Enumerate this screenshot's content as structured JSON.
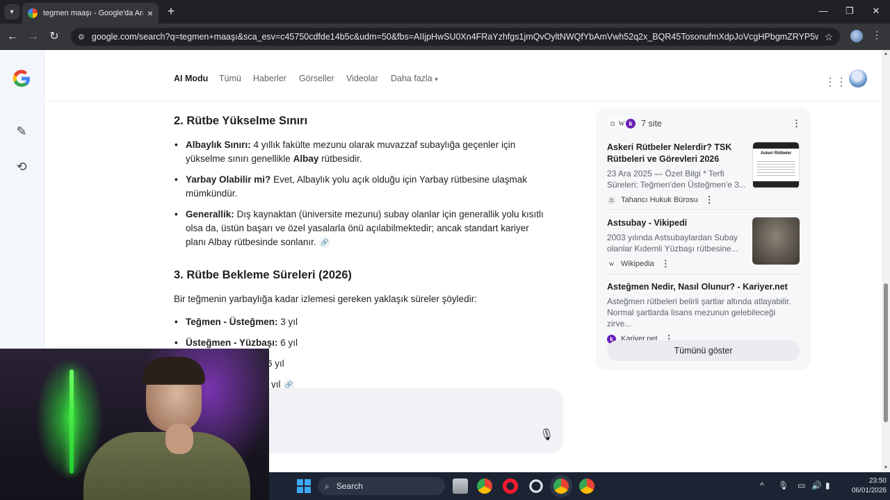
{
  "browser": {
    "tab_title": "tegmen maaşı - Google'da Ara",
    "url": "google.com/search?q=tegmen+maaşı&sca_esv=c45750cdfde14b5c&udm=50&fbs=AIIjpHwSU0Xn4FRaYzhfgs1jmQvOyltNWQfYbAmVwh52q2x_BQR45TosonufmXdpJoVcgHPbgmZRYP5wvwDSdRngeU..."
  },
  "google_nav": {
    "tabs": [
      "AI Modu",
      "Tümü",
      "Haberler",
      "Görseller",
      "Videolar",
      "Daha fazla"
    ],
    "active_tab": "AI Modu"
  },
  "content": {
    "section2_title": "2. Rütbe Yükselme Sınırı",
    "bullets2": [
      {
        "bold": "Albaylık Sınırı:",
        "text_a": " 4 yıllık fakülte mezunu olarak muvazzaf subaylığa geçenler için yükselme sınırı genellikle ",
        "bold2": "Albay",
        "text_b": " rütbesidir."
      },
      {
        "bold": "Yarbay Olabilir mi?",
        "text_a": " Evet, Albaylık yolu açık olduğu için Yarbay rütbesine ulaşmak mümkündür."
      },
      {
        "bold": "Generallik:",
        "text_a": " Dış kaynaktan (üniversite mezunu) subay olanlar için generallik yolu kısıtlı olsa da, üstün başarı ve özel yasalarla önü açılabilmektedir; ancak standart kariyer planı Albay rütbesinde sonlanır."
      }
    ],
    "section3_title": "3. Rütbe Bekleme Süreleri (2026)",
    "section3_intro": "Bir teğmenin yarbaylığa kadar izlemesi gereken yaklaşık süreler şöyledir:",
    "bullets3": [
      {
        "bold": "Teğmen - Üsteğmen:",
        "text": " 3 yıl"
      },
      {
        "bold": "Üsteğmen - Yüzbaşı:",
        "text": " 6 yıl"
      },
      {
        "bold": "",
        "text": "6 yıl"
      },
      {
        "bold": "",
        "text": "yıl"
      }
    ]
  },
  "sources": {
    "count_label": "7 site",
    "items": [
      {
        "title": "Askeri Rütbeler Nelerdir? TSK Rütbeleri ve Görevleri 2026",
        "snippet": "23 Ara 2025 — Özet Bilgi * Terfi Süreleri: Teğmen'den Üsteğmen'e 3...",
        "site": "Tahancı Hukuk Bürosu",
        "thumb_label": "Askeri Rütbeler"
      },
      {
        "title": "Astsubay - Vikipedi",
        "snippet": "2003 yılında Astsubaylardan Subay olanlar Kıdemli Yüzbaşı rütbesine...",
        "site": "Wikipedia"
      },
      {
        "title": "Asteğmen Nedir, Nasıl Olunur? - Kariyer.net",
        "snippet": "Asteğmen rütbeleri belirli şartlar altında atlayabilir. Normal şartlarda lisans mezunun gelebileceği zirve...",
        "site": "Kariyer.net"
      }
    ],
    "show_all": "Tümünü göster"
  },
  "taskbar": {
    "search_label": "Search",
    "time": "23:50",
    "date": "06/01/2026"
  },
  "colors": {
    "chrome_dark": "#202124",
    "chrome_toolbar": "#35363a",
    "taskbar": "#1c2433",
    "accent_blue": "#4285f4",
    "kariyer_purple": "#6a1fb5"
  }
}
